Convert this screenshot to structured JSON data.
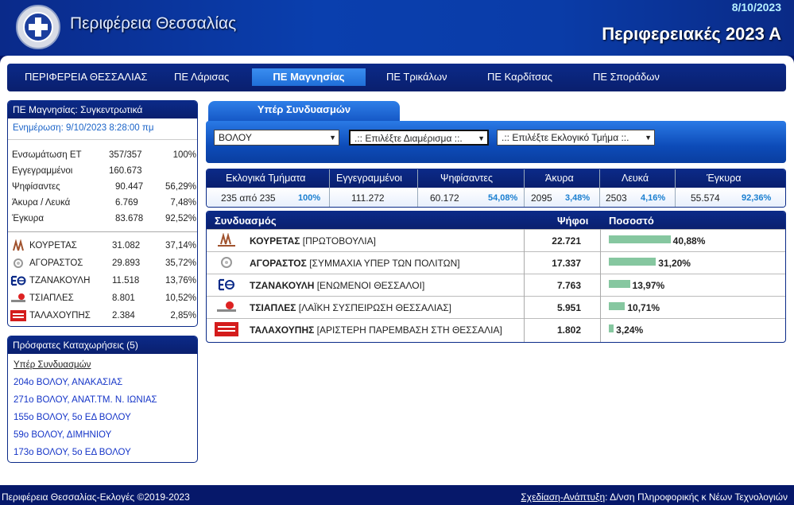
{
  "header": {
    "brand": "Περιφέρεια Θεσσαλίας",
    "date": "8/10/2023",
    "title": "Περιφερειακές 2023 Α"
  },
  "nav": [
    "ΠΕΡΙΦΕΡΕΙΑ ΘΕΣΣΑΛΙΑΣ",
    "ΠΕ Λάρισας",
    "ΠΕ Μαγνησίας",
    "ΠΕ Τρικάλων",
    "ΠΕ Καρδίτσας",
    "ΠΕ Σποράδων"
  ],
  "summary": {
    "title": "ΠΕ Μαγνησίας: Συγκεντρωτικά",
    "updated": "Ενημέρωση: 9/10/2023 8:28:00 πμ",
    "rows": [
      {
        "label": "Ενσωμάτωση ΕΤ",
        "value": "357/357",
        "pct": "100%"
      },
      {
        "label": "Εγγεγραμμένοι",
        "value": "160.673",
        "pct": ""
      },
      {
        "label": "Ψηφίσαντες",
        "value": "90.447",
        "pct": "56,29%"
      },
      {
        "label": "Άκυρα / Λευκά",
        "value": "6.769",
        "pct": "7,48%"
      },
      {
        "label": "Έγκυρα",
        "value": "83.678",
        "pct": "92,52%"
      }
    ],
    "candidates": [
      {
        "name": "ΚΟΥΡΕΤΑΣ",
        "value": "31.082",
        "pct": "37,14%"
      },
      {
        "name": "ΑΓΟΡΑΣΤΟΣ",
        "value": "29.893",
        "pct": "35,72%"
      },
      {
        "name": "ΤΖΑΝΑΚΟΥΛΗ",
        "value": "11.518",
        "pct": "13,76%"
      },
      {
        "name": "ΤΣΙΑΠΛΕΣ",
        "value": "8.801",
        "pct": "10,52%"
      },
      {
        "name": "ΤΑΛΑΧΟΥΠΗΣ",
        "value": "2.384",
        "pct": "2,85%"
      }
    ]
  },
  "recent": {
    "title": "Πρόσφατες Καταχωρήσεις (5)",
    "subtitle": "Υπέρ Συνδυασμών",
    "items": [
      "204ο ΒΟΛΟΥ, ΑΝΑΚΑΣΙΑΣ",
      "271ο ΒΟΛΟΥ, ΑΝΑΤ.ΤΜ. Ν. ΙΩΝΙΑΣ",
      "155ο ΒΟΛΟΥ, 5ο ΕΔ ΒΟΛΟΥ",
      "59ο ΒΟΛΟΥ, ΔΙΜΗΝΙΟΥ",
      "173ο ΒΟΛΟΥ, 5ο ΕΔ ΒΟΛΟΥ"
    ]
  },
  "tab": "Υπέρ Συνδυασμών",
  "selects": {
    "municipality": "ΒΟΛΟΥ",
    "district": ".:: Επιλέξτε Διαμέρισμα ::.",
    "section": ".:: Επιλέξτε Εκλογικό Τμήμα ::."
  },
  "stats": {
    "headers": [
      "Εκλογικά Τμήματα",
      "Εγγεγραμμένοι",
      "Ψηφίσαντες",
      "Άκυρα",
      "Λευκά",
      "Έγκυρα"
    ],
    "values": [
      {
        "v": "235 από 235",
        "p": "100%"
      },
      {
        "v": "111.272",
        "p": ""
      },
      {
        "v": "60.172",
        "p": "54,08%"
      },
      {
        "v": "2095",
        "p": "3,48%"
      },
      {
        "v": "2503",
        "p": "4,16%"
      },
      {
        "v": "55.574",
        "p": "92,36%"
      }
    ]
  },
  "results": {
    "headers": [
      "Συνδυασμός",
      "Ψήφοι",
      "Ποσοστό"
    ],
    "rows": [
      {
        "name": "ΚΟΥΡΕΤΑΣ",
        "party": "[ΠΡΩΤΟΒΟΥΛΙΑ]",
        "votes": "22.721",
        "pct": "40,88%",
        "share": 40.88
      },
      {
        "name": "ΑΓΟΡΑΣΤΟΣ",
        "party": "[ΣΥΜΜΑΧΙΑ ΥΠΕΡ ΤΩΝ ΠΟΛΙΤΩΝ]",
        "votes": "17.337",
        "pct": "31,20%",
        "share": 31.2
      },
      {
        "name": "ΤΖΑΝΑΚΟΥΛΗ",
        "party": "[ΕΝΩΜΕΝΟΙ ΘΕΣΣΑΛΟΙ]",
        "votes": "7.763",
        "pct": "13,97%",
        "share": 13.97
      },
      {
        "name": "ΤΣΙΑΠΛΕΣ",
        "party": "[ΛΑΪΚΗ ΣΥΣΠΕΙΡΩΣΗ ΘΕΣΣΑΛΙΑΣ]",
        "votes": "5.951",
        "pct": "10,71%",
        "share": 10.71
      },
      {
        "name": "ΤΑΛΑΧΟΥΠΗΣ",
        "party": "[ΑΡΙΣΤΕΡΗ ΠΑΡΕΜΒΑΣΗ ΣΤΗ ΘΕΣΣΑΛΙΑ]",
        "votes": "1.802",
        "pct": "3,24%",
        "share": 3.24
      }
    ]
  },
  "footer": {
    "left": "Περιφέρεια Θεσσαλίας-Εκλογές ©2019-2023",
    "credit_link": "Σχεδίαση-Ανάπτυξη",
    "credit_rest": ": Δ/νση Πληροφορικής κ Νέων Τεχνολογιών"
  },
  "colors": {
    "navy": "#0a2a88",
    "accent": "#1f6fd8",
    "pct_text": "#1a7fd0",
    "bar": "#86c7a0",
    "link": "#1535c8"
  }
}
